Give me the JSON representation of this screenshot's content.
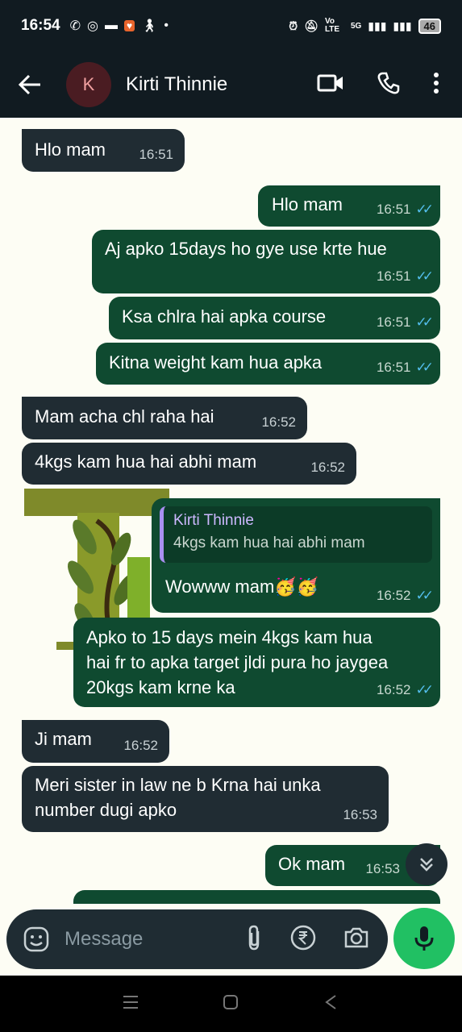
{
  "status_bar": {
    "time": "16:54",
    "network": "5G",
    "volte": "Vo LTE",
    "battery": "46"
  },
  "header": {
    "avatar_letter": "K",
    "contact_name": "Kirti Thinnie"
  },
  "messages": [
    {
      "text": "Hlo mam",
      "time": "16:51"
    },
    {
      "text": "Hlo mam",
      "time": "16:51"
    },
    {
      "text": "Aj apko 15days ho gye use krte hue",
      "time": "16:51"
    },
    {
      "text": "Ksa chlra hai apka course",
      "time": "16:51"
    },
    {
      "text": "Kitna weight kam hua apka",
      "time": "16:51"
    },
    {
      "text": "Mam acha chl raha hai",
      "time": "16:52"
    },
    {
      "text": "4kgs kam hua hai abhi mam",
      "time": "16:52"
    },
    {
      "quote_name": "Kirti Thinnie",
      "quote_text": "4kgs kam hua hai abhi mam",
      "text": "Wowww mam🥳🥳",
      "time": "16:52"
    },
    {
      "text": "Apko to 15 days mein 4kgs kam hua hai fr to apka target jldi pura ho jaygea 20kgs kam krne ka",
      "time": "16:52"
    },
    {
      "text": "Ji mam",
      "time": "16:52"
    },
    {
      "text": "Meri sister in law ne b Krna hai unka number dugi apko",
      "time": "16:53"
    },
    {
      "text": "Ok mam",
      "time": "16:53"
    }
  ],
  "input": {
    "placeholder": "Message"
  },
  "colors": {
    "header_bg": "#111b21",
    "incoming": "#202c33",
    "outgoing": "#0f4a30",
    "mic": "#21c063",
    "ticks": "#53bdeb"
  }
}
